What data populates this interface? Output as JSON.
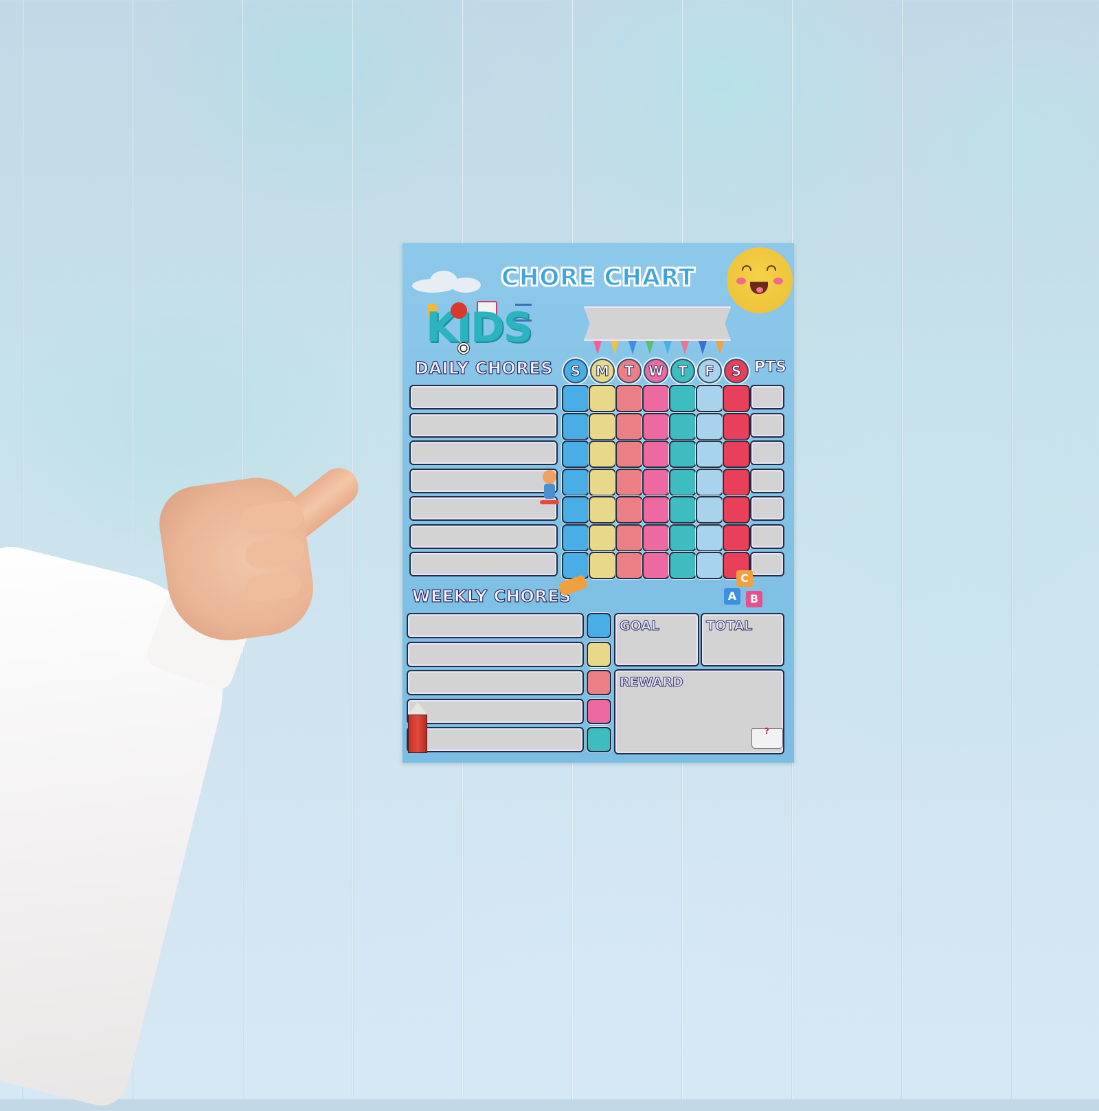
{
  "scene": {
    "description": "Hand pointing at a children's chore chart poster on a light blue plank wall",
    "wall_color": "#c6dfea",
    "sleeve_color": "#f6f4f3",
    "skin_color": "#ecb898"
  },
  "poster": {
    "title": "CHORE CHART",
    "logo_text": "KIDS",
    "name_banner_value": "",
    "daily": {
      "label": "DAILY CHORES",
      "days": [
        {
          "letter": "S",
          "color": "#4aaee6"
        },
        {
          "letter": "M",
          "color": "#e8d98a"
        },
        {
          "letter": "T",
          "color": "#ea7f86"
        },
        {
          "letter": "W",
          "color": "#ec6aa0"
        },
        {
          "letter": "T",
          "color": "#3fbcbf"
        },
        {
          "letter": "F",
          "color": "#a9d3ec"
        },
        {
          "letter": "S",
          "color": "#e8405a"
        }
      ],
      "points_label": "PTS",
      "rows": [
        {
          "chore": "",
          "pts": ""
        },
        {
          "chore": "",
          "pts": ""
        },
        {
          "chore": "",
          "pts": ""
        },
        {
          "chore": "",
          "pts": ""
        },
        {
          "chore": "",
          "pts": ""
        },
        {
          "chore": "",
          "pts": ""
        },
        {
          "chore": "",
          "pts": ""
        }
      ]
    },
    "weekly": {
      "label": "WEEKLY CHORES",
      "rows": [
        {
          "chore": "",
          "color": "#4aaee6"
        },
        {
          "chore": "",
          "color": "#e8d98a"
        },
        {
          "chore": "",
          "color": "#ea7f86"
        },
        {
          "chore": "",
          "color": "#ec6aa0"
        },
        {
          "chore": "",
          "color": "#3fbcbf"
        }
      ]
    },
    "goal_label": "GOAL",
    "total_label": "TOTAL",
    "reward_label": "REWARD",
    "goal_value": "",
    "total_value": "",
    "reward_value": "",
    "blocks": [
      {
        "letter": "C",
        "color": "#f0a040"
      },
      {
        "letter": "A",
        "color": "#3f8fe0"
      },
      {
        "letter": "B",
        "color": "#e8508a"
      }
    ],
    "flag_colors": [
      "#f0609a",
      "#f2c040",
      "#3f8fe0",
      "#58c070",
      "#4ab0e0",
      "#f07090",
      "#3f70d0",
      "#f2a040"
    ]
  }
}
